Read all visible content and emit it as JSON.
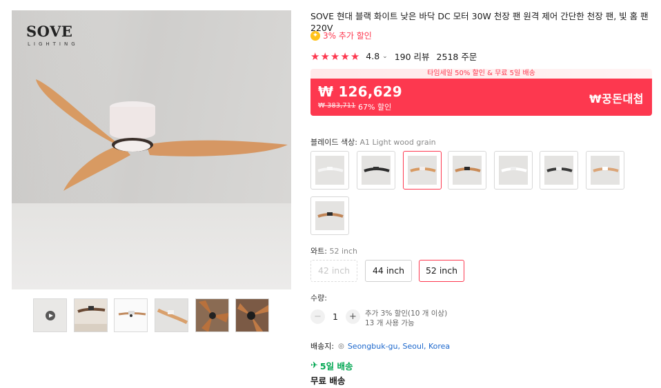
{
  "gallery": {
    "brand_logo": "SOVE",
    "brand_logo_sub": "LIGHTING",
    "thumbnails": [
      {
        "icon": "play-icon"
      },
      {},
      {},
      {},
      {},
      {}
    ]
  },
  "product": {
    "title": "SOVE 현대 블랙 화이트 낮은 바닥 DC 모터 30W 천장 팬 원격 제어 간단한 천장 팬, 빛 홈 팬 220V",
    "promo_icon": "coin-icon",
    "promo_text": "3% 추가 할인",
    "rating": "4.8",
    "rating_stars": 5,
    "reviews": "190 리뷰",
    "orders": "2518 주문"
  },
  "price": {
    "sale_banner": "타임세일 50% 할인 & 무료 5일 배송",
    "current": "₩ 126,629",
    "original": "₩ 383,711",
    "discount": "67% 할인",
    "badge": "₩꿍돈대첩",
    "accent_color": "#fd384f"
  },
  "options": {
    "blade_label": "블레이드 색상:",
    "blade_value": "A1 Light wood grain",
    "blade_swatches": 8,
    "watt_label": "와트:",
    "watt_value": "52 inch",
    "sizes": [
      "42 inch",
      "44 inch",
      "52 inch"
    ]
  },
  "quantity": {
    "label": "수량:",
    "value": "1",
    "minus": "−",
    "plus": "+",
    "note_line1": "추가 3% 할인(10 개 이상)",
    "note_line2": "13 개 사용 가능"
  },
  "shipping": {
    "label": "배송지:",
    "location": "Seongbuk-gu, Seoul, Korea",
    "fast": "5일 배송",
    "free": "무료 배송"
  }
}
